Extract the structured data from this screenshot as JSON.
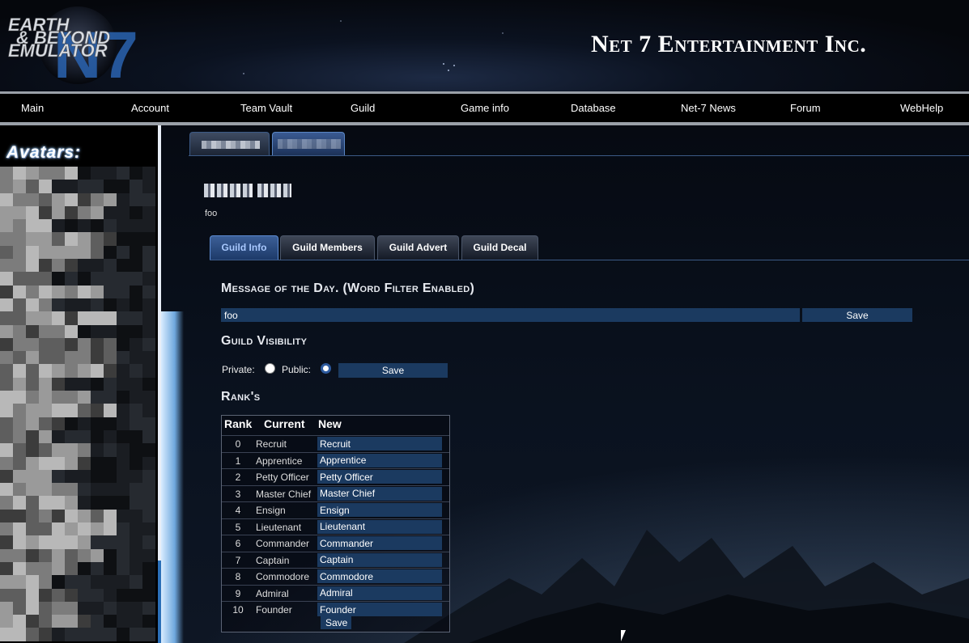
{
  "header": {
    "logo_lines": [
      "EARTH",
      "& BEYOND",
      "EMULATOR"
    ],
    "logo_mark": "N7",
    "site_title": "Net 7 Entertainment Inc."
  },
  "nav": {
    "items": [
      "Main",
      "Account",
      "Team Vault",
      "Guild",
      "Game info",
      "Database",
      "Net-7 News",
      "Forum",
      "WebHelp"
    ]
  },
  "sidebar": {
    "title": "Avatars:"
  },
  "guild": {
    "tag": "foo",
    "tabs": [
      "Guild Info",
      "Guild Members",
      "Guild Advert",
      "Guild Decal"
    ],
    "active_tab": "Guild Info",
    "motd": {
      "title": "Message of the Day. (Word Filter Enabled)",
      "value": "foo",
      "save_label": "Save"
    },
    "visibility": {
      "title": "Guild Visibility",
      "private_label": "Private:",
      "public_label": "Public:",
      "selected": "public",
      "save_label": "Save"
    },
    "ranks": {
      "title": "Rank's",
      "headers": [
        "Rank",
        "Current",
        "New"
      ],
      "rows": [
        {
          "rank": "0",
          "current": "Recruit",
          "new": "Recruit"
        },
        {
          "rank": "1",
          "current": "Apprentice",
          "new": "Apprentice"
        },
        {
          "rank": "2",
          "current": "Petty Officer",
          "new": "Petty Officer"
        },
        {
          "rank": "3",
          "current": "Master Chief",
          "new": "Master Chief"
        },
        {
          "rank": "4",
          "current": "Ensign",
          "new": "Ensign"
        },
        {
          "rank": "5",
          "current": "Lieutenant",
          "new": "Lieutenant"
        },
        {
          "rank": "6",
          "current": "Commander",
          "new": "Commander"
        },
        {
          "rank": "7",
          "current": "Captain",
          "new": "Captain"
        },
        {
          "rank": "8",
          "current": "Commodore",
          "new": "Commodore"
        },
        {
          "rank": "9",
          "current": "Admiral",
          "new": "Admiral"
        },
        {
          "rank": "10",
          "current": "Founder",
          "new": "Founder"
        }
      ],
      "save_label": "Save"
    }
  },
  "colors": {
    "field_bg": "#1b3a60",
    "active_tab_text": "#a9c9ff",
    "accent": "#2b6fb8"
  }
}
